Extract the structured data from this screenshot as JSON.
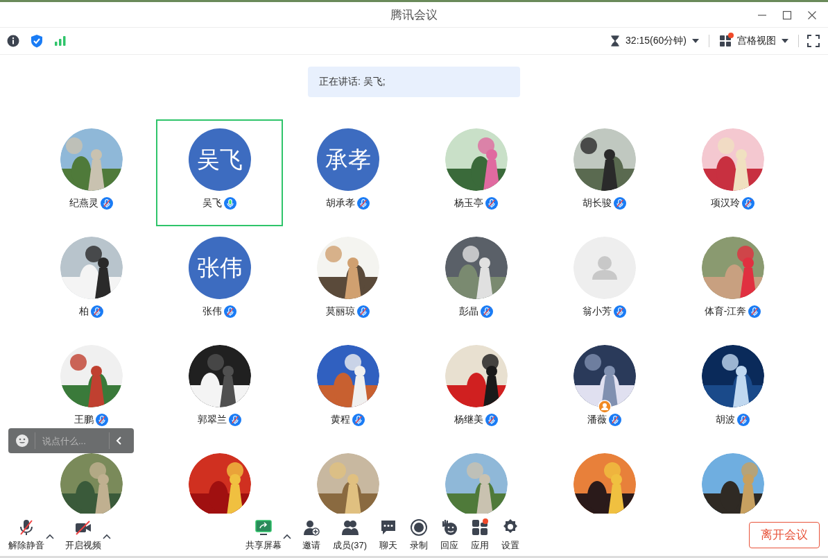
{
  "window": {
    "title": "腾讯会议"
  },
  "toolbar": {
    "timer": "32:15(60分钟)",
    "view": "宫格视图",
    "view_badge": true
  },
  "speaking": "正在讲话: 吴飞;",
  "participants": [
    {
      "name": "纪燕灵",
      "muted": true,
      "selected": false,
      "host": false
    },
    {
      "name": "吴飞",
      "avatar": {
        "kind": "text",
        "text": "吴飞"
      },
      "muted": false,
      "selected": true,
      "host": false
    },
    {
      "name": "胡承孝",
      "avatar": {
        "kind": "text",
        "text": "承孝"
      },
      "muted": true,
      "selected": false,
      "host": false
    },
    {
      "name": "杨玉亭",
      "muted": true,
      "selected": false,
      "host": false
    },
    {
      "name": "胡长骏",
      "muted": true,
      "selected": false,
      "host": false
    },
    {
      "name": "项汉玲",
      "muted": true,
      "selected": false,
      "host": false
    },
    {
      "name": "柏",
      "muted": true,
      "selected": false,
      "host": false
    },
    {
      "name": "张伟",
      "avatar": {
        "kind": "text",
        "text": "张伟"
      },
      "muted": true,
      "selected": false,
      "host": false
    },
    {
      "name": "莫丽琼",
      "muted": true,
      "selected": false,
      "host": false
    },
    {
      "name": "彭晶",
      "muted": true,
      "selected": false,
      "host": false
    },
    {
      "name": "翁小芳",
      "avatar": {
        "kind": "placeholder"
      },
      "muted": true,
      "selected": false,
      "host": false
    },
    {
      "name": "体育-江奔",
      "muted": true,
      "selected": false,
      "host": false
    },
    {
      "name": "王鹏",
      "muted": true,
      "selected": false,
      "host": false
    },
    {
      "name": "郭翠兰",
      "muted": true,
      "selected": false,
      "host": false
    },
    {
      "name": "黄程",
      "muted": true,
      "selected": false,
      "host": false
    },
    {
      "name": "杨继美",
      "muted": true,
      "selected": false,
      "host": false
    },
    {
      "name": "潘薇",
      "muted": true,
      "selected": false,
      "host": true
    },
    {
      "name": "胡波",
      "muted": true,
      "selected": false,
      "host": false
    },
    {
      "selected": false,
      "host": false
    },
    {
      "selected": false,
      "host": false
    },
    {
      "selected": false,
      "host": false
    },
    {
      "selected": false,
      "host": false
    },
    {
      "selected": false,
      "host": false
    },
    {
      "selected": false,
      "host": false
    }
  ],
  "chat": {
    "placeholder": "说点什么..."
  },
  "controls": [
    {
      "kind": "mic",
      "label": "解除静音",
      "caret": true
    },
    {
      "kind": "video",
      "label": "开启视频",
      "caret": true
    },
    {
      "kind": "share",
      "label": "共享屏幕",
      "caret": true
    },
    {
      "kind": "invite",
      "label": "邀请",
      "caret": false
    },
    {
      "kind": "members",
      "label": "成员(37)",
      "caret": false
    },
    {
      "kind": "chat",
      "label": "聊天",
      "caret": false
    },
    {
      "kind": "record",
      "label": "录制",
      "caret": false
    },
    {
      "kind": "react",
      "label": "回应",
      "caret": false
    },
    {
      "kind": "apps",
      "label": "应用",
      "caret": false
    },
    {
      "kind": "settings",
      "label": "设置",
      "caret": false
    }
  ],
  "leave": "离开会议"
}
